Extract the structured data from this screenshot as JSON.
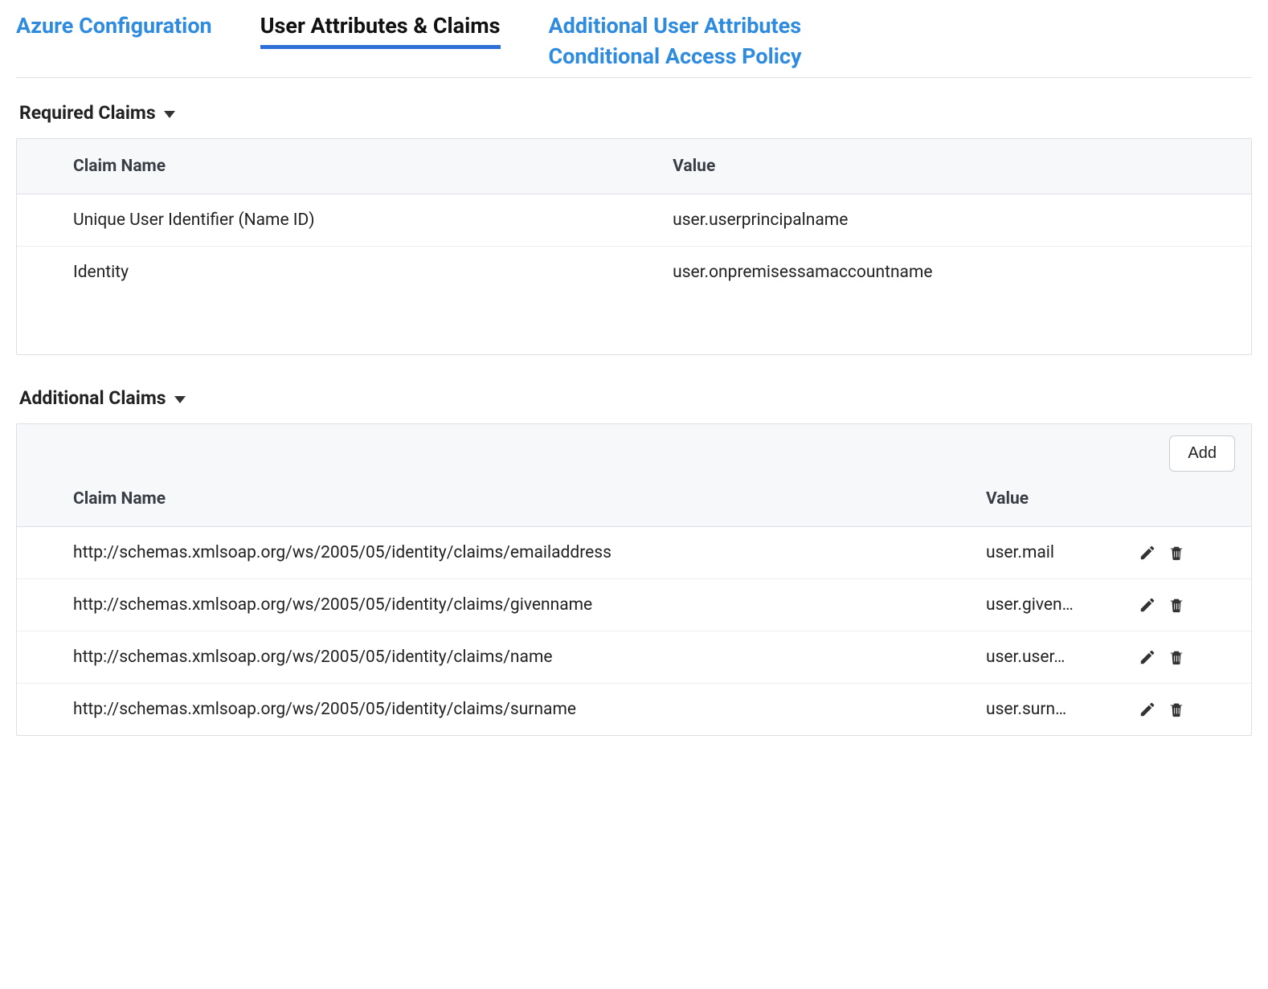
{
  "tabs": {
    "azure_config": "Azure Configuration",
    "user_attrs": "User Attributes & Claims",
    "additional_attrs": "Additional User Attributes",
    "conditional_policy": "Conditional Access Policy"
  },
  "required": {
    "heading": "Required Claims",
    "columns": {
      "name": "Claim Name",
      "value": "Value"
    },
    "rows": [
      {
        "name": "Unique User Identifier (Name ID)",
        "value": "user.userprincipalname"
      },
      {
        "name": "Identity",
        "value": "user.onpremisessamaccountname"
      }
    ]
  },
  "additional": {
    "heading": "Additional Claims",
    "add_label": "Add",
    "columns": {
      "name": "Claim Name",
      "value": "Value"
    },
    "rows": [
      {
        "name": "http://schemas.xmlsoap.org/ws/2005/05/identity/claims/emailaddress",
        "value": "user.mail"
      },
      {
        "name": "http://schemas.xmlsoap.org/ws/2005/05/identity/claims/givenname",
        "value": "user.given…"
      },
      {
        "name": "http://schemas.xmlsoap.org/ws/2005/05/identity/claims/name",
        "value": "user.user…"
      },
      {
        "name": "http://schemas.xmlsoap.org/ws/2005/05/identity/claims/surname",
        "value": "user.surn…"
      }
    ]
  }
}
